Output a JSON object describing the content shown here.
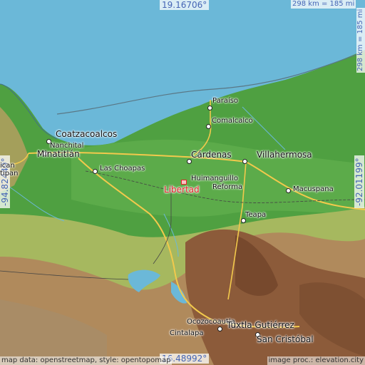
{
  "coordinates": {
    "north": "19.16706°",
    "south": "16.48992°",
    "west": "-94.82449°",
    "east": "-92.01199°"
  },
  "scale": {
    "horizontal": "298 km = 185 mi",
    "vertical": "298 km = 185 mi"
  },
  "highlight_place": "Libertad",
  "places": {
    "paraiso": "Paraíso",
    "comalcalco": "Comalcalco",
    "coatzacoalcos": "Coatzacoalcos",
    "nanchital": "Nanchital",
    "minatitlan": "Minatitlán",
    "cardenas": "Cárdenas",
    "villahermosa": "Villahermosa",
    "las_choapas": "Las Choapas",
    "huimanguillo": "Huimanguillo",
    "reforma": "Reforma",
    "macuspana": "Macuspana",
    "teapa": "Teapa",
    "ocozocoautla": "Ocozocoautla",
    "tuxtla": "Tuxtla Gutiérrez",
    "cintalapa": "Cintalapa",
    "san_cristobal": "San Cristóbal",
    "left_edge_1": "ican",
    "left_edge_2": "tipan"
  },
  "credits": {
    "left": "map data: openstreetmap, style: opentopomap",
    "right": "image proc.: elevation.city"
  },
  "colors": {
    "sea": "#6bb8d8",
    "lowland": "#4c9e3f",
    "highland": "#a57c52",
    "highlight": "#e8202a",
    "coord_text": "#4565b5"
  },
  "icons": [
    "city-dot-icon",
    "location-marker-icon"
  ]
}
